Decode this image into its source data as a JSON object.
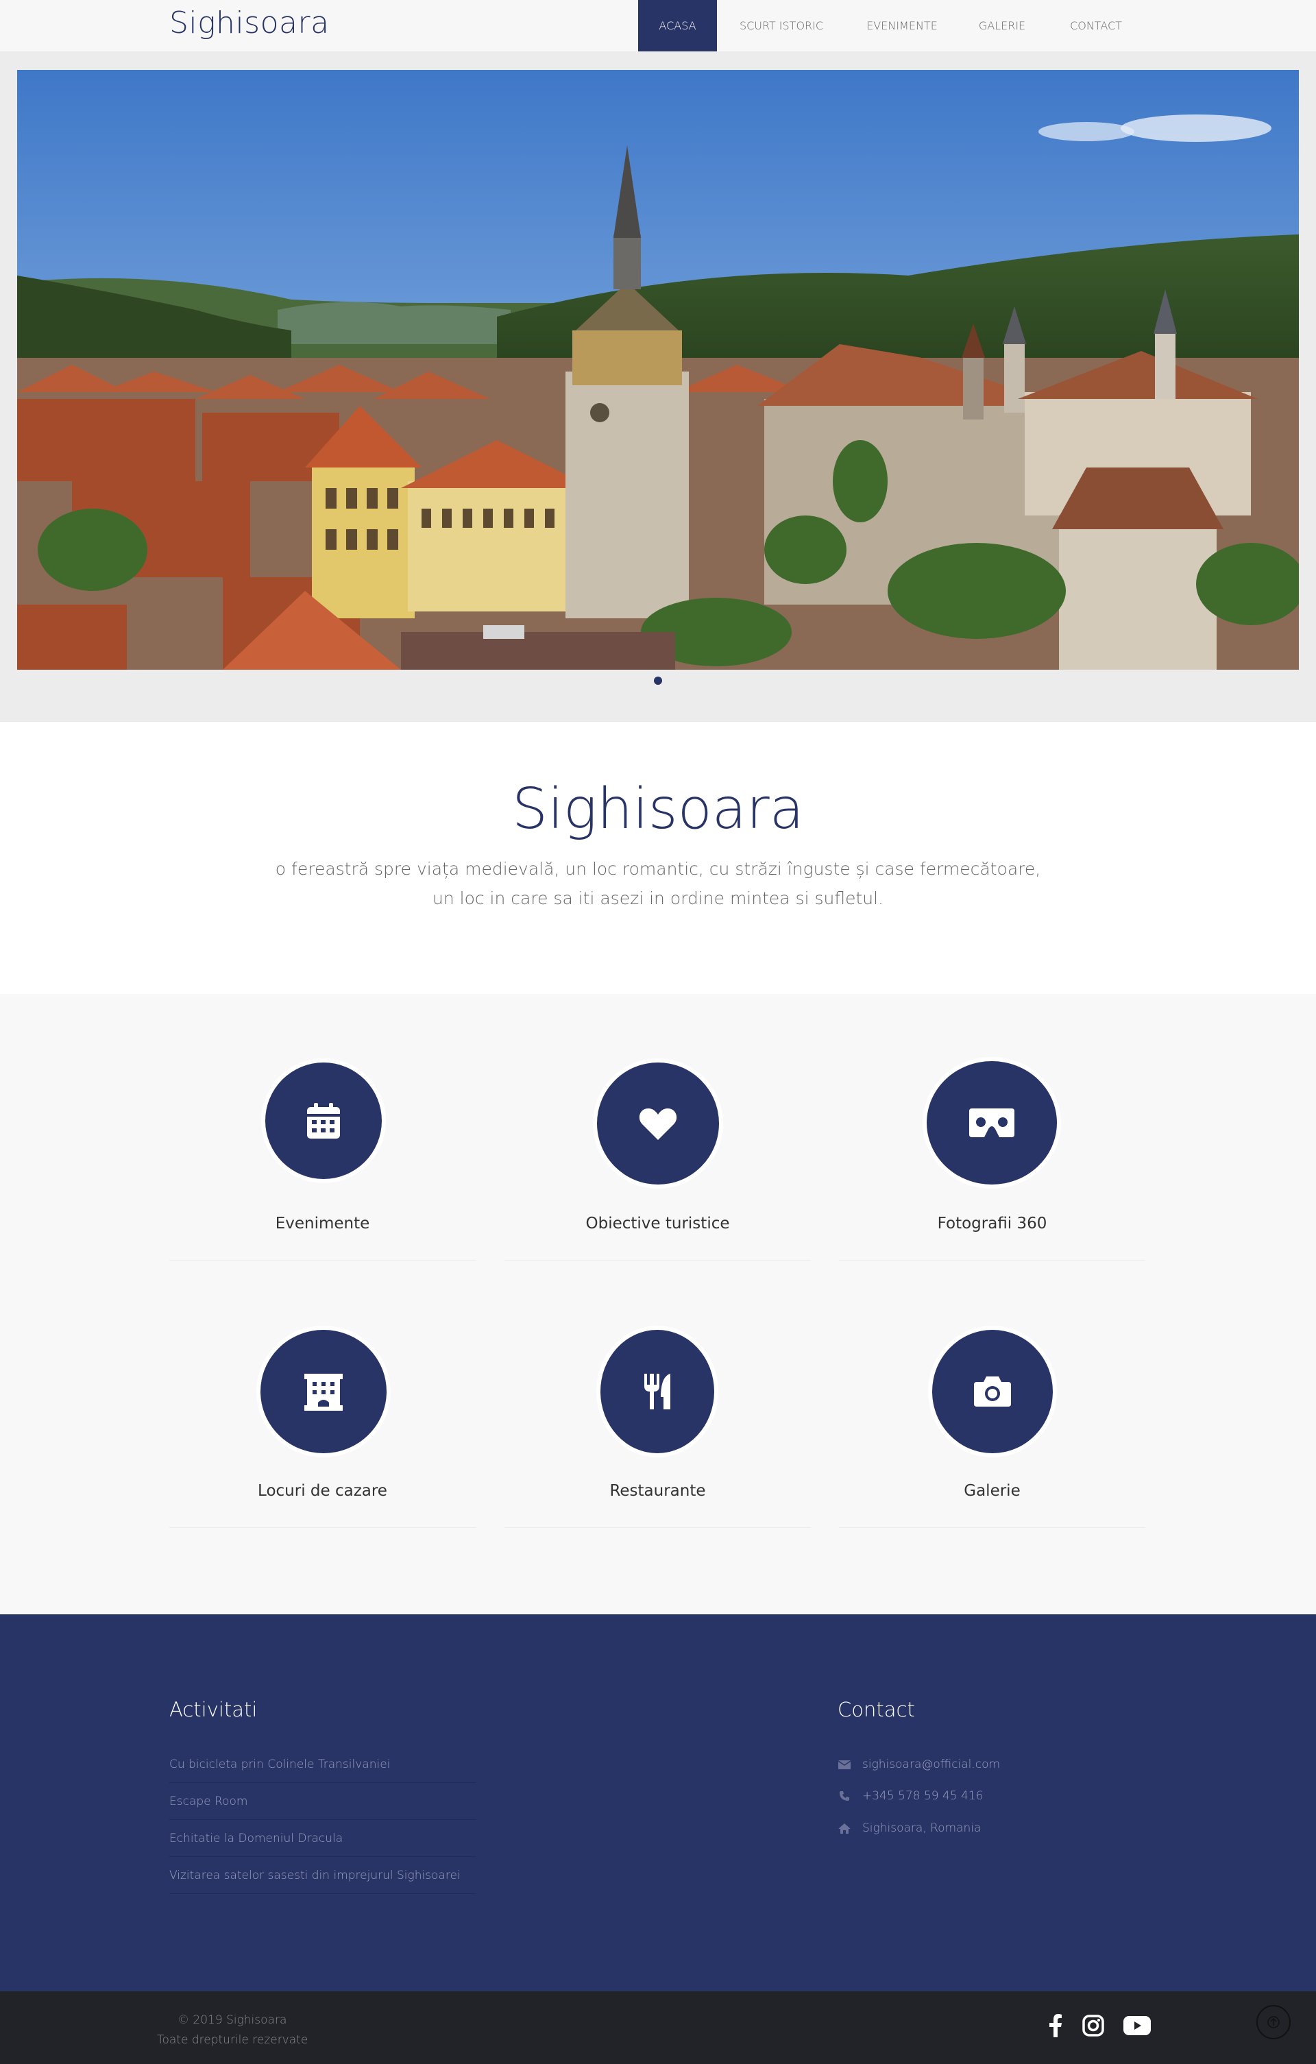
{
  "header": {
    "logo": "Sighisoara",
    "nav": [
      "ACASA",
      "SCURT ISTORIC",
      "EVENIMENTE",
      "GALERIE",
      "CONTACT"
    ],
    "active_nav": "ACASA"
  },
  "hero": {
    "slide_count": 1,
    "image_icon": "sighisoara-citadel-photo"
  },
  "intro": {
    "title": "Sighisoara",
    "line1": "o fereastră spre viața medievală, un loc romantic, cu străzi înguste și case fermecătoare,",
    "line2": "un loc in care sa iti asezi in ordine mintea si sufletul."
  },
  "services": [
    {
      "label": "Evenimente",
      "icon": "calendar-icon"
    },
    {
      "label": "Obiective turistice",
      "icon": "heart-icon"
    },
    {
      "label": "Fotografii 360",
      "icon": "vr-cardboard-icon"
    },
    {
      "label": "Locuri de cazare",
      "icon": "hotel-icon"
    },
    {
      "label": "Restaurante",
      "icon": "utensils-icon"
    },
    {
      "label": "Galerie",
      "icon": "camera-icon"
    }
  ],
  "footer": {
    "activities_title": "Activitati",
    "activities": [
      "Cu bicicleta prin Colinele Transilvaniei",
      "Escape Room",
      "Echitatie la Domeniul Dracula",
      "Vizitarea satelor sasesti din imprejurul Sighisoarei"
    ],
    "contact_title": "Contact",
    "contact": [
      {
        "icon": "envelope-icon",
        "text": "sighisoara@official.com"
      },
      {
        "icon": "phone-icon",
        "text": "+345 578 59 45 416"
      },
      {
        "icon": "home-icon",
        "text": "Sighisoara, Romania"
      }
    ]
  },
  "bottom": {
    "copyright": "© 2019 Sighisoara",
    "rights": "Toate drepturile rezervate",
    "social": [
      "facebook-icon",
      "instagram-icon",
      "youtube-icon"
    ],
    "to_top_icon": "arrow-up-icon"
  },
  "colors": {
    "brand": "#283366",
    "footer_bottom": "#222328"
  }
}
